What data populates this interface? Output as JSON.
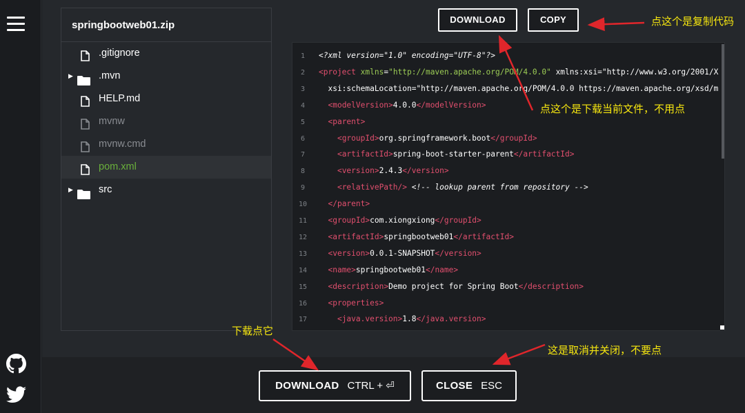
{
  "file_tree": {
    "title": "springbootweb01.zip",
    "items": [
      {
        "label": ".gitignore",
        "type": "file",
        "state": "normal"
      },
      {
        "label": ".mvn",
        "type": "folder",
        "state": "normal"
      },
      {
        "label": "HELP.md",
        "type": "file",
        "state": "normal"
      },
      {
        "label": "mvnw",
        "type": "file",
        "state": "dim"
      },
      {
        "label": "mvnw.cmd",
        "type": "file",
        "state": "dim"
      },
      {
        "label": "pom.xml",
        "type": "file",
        "state": "selected"
      },
      {
        "label": "src",
        "type": "folder",
        "state": "normal"
      }
    ]
  },
  "toolbar": {
    "download_label": "DOWNLOAD",
    "copy_label": "COPY"
  },
  "code": {
    "lines": [
      {
        "n": "1",
        "t": "<?xml version=\"1.0\" encoding=\"UTF-8\"?>"
      },
      {
        "n": "2",
        "t": "<project xmlns=\"http://maven.apache.org/POM/4.0.0\" xmlns:xsi=\"http://www.w3.org/2001/X"
      },
      {
        "n": "3",
        "t": "  xsi:schemaLocation=\"http://maven.apache.org/POM/4.0.0 https://maven.apache.org/xsd/m"
      },
      {
        "n": "4",
        "t": "  <modelVersion>4.0.0</modelVersion>"
      },
      {
        "n": "5",
        "t": "  <parent>"
      },
      {
        "n": "6",
        "t": "    <groupId>org.springframework.boot</groupId>"
      },
      {
        "n": "7",
        "t": "    <artifactId>spring-boot-starter-parent</artifactId>"
      },
      {
        "n": "8",
        "t": "    <version>2.4.3</version>"
      },
      {
        "n": "9",
        "t": "    <relativePath/> <!-- lookup parent from repository -->"
      },
      {
        "n": "10",
        "t": "  </parent>"
      },
      {
        "n": "11",
        "t": "  <groupId>com.xiongxiong</groupId>"
      },
      {
        "n": "12",
        "t": "  <artifactId>springbootweb01</artifactId>"
      },
      {
        "n": "13",
        "t": "  <version>0.0.1-SNAPSHOT</version>"
      },
      {
        "n": "14",
        "t": "  <name>springbootweb01</name>"
      },
      {
        "n": "15",
        "t": "  <description>Demo project for Spring Boot</description>"
      },
      {
        "n": "16",
        "t": "  <properties>"
      },
      {
        "n": "17",
        "t": "    <java.version>1.8</java.version>"
      }
    ]
  },
  "footer": {
    "download_label": "DOWNLOAD",
    "download_shortcut": "CTRL + ⏎",
    "close_label": "CLOSE",
    "close_shortcut": "ESC"
  },
  "annotations": {
    "copy_note": "点这个是复制代码",
    "download_file_note": "点这个是下载当前文件，不用点",
    "download_note": "下载点它",
    "close_note": "这是取消并关闭，不要点"
  },
  "colors": {
    "annotation": "#f7e70f",
    "arrow": "#e0262b",
    "selected_file": "#6ab03b",
    "xml_tag": "#e24f6e",
    "xml_attr": "#9ccc55"
  }
}
